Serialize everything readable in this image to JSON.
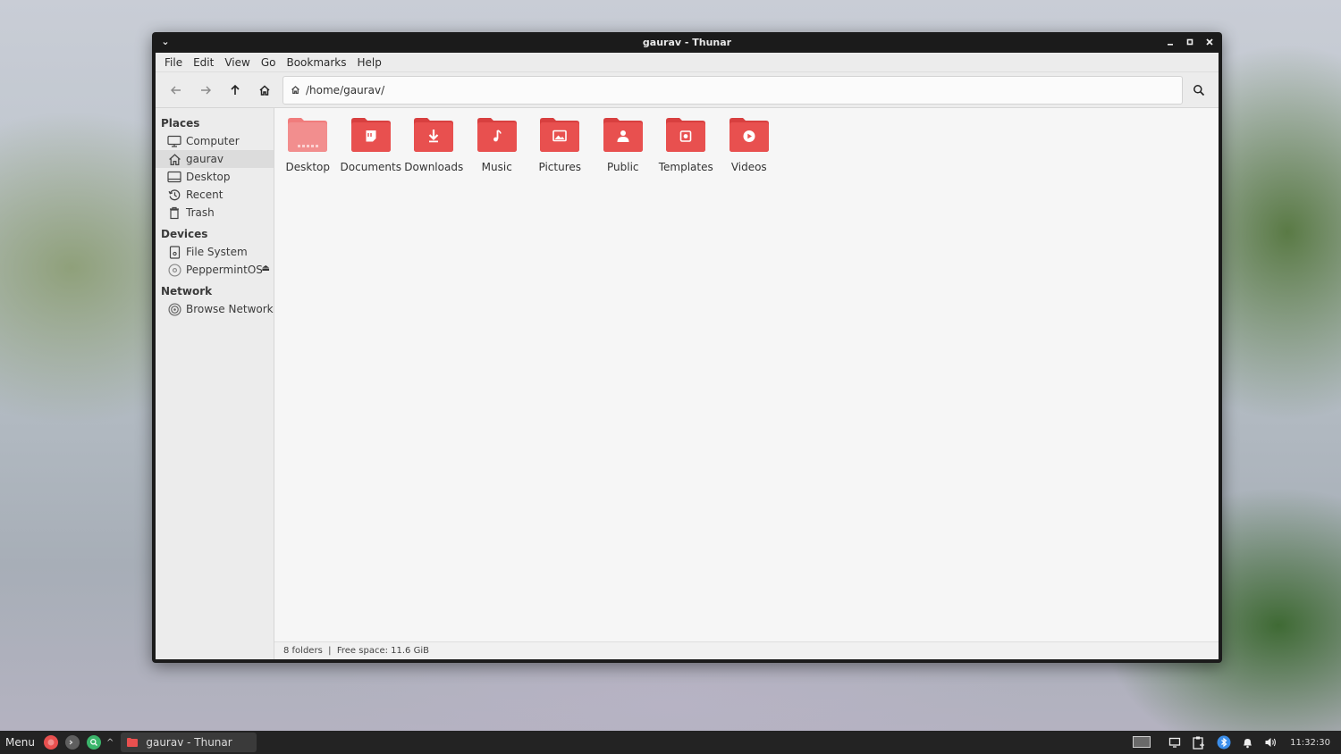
{
  "window": {
    "title": "gaurav - Thunar"
  },
  "menubar": {
    "items": [
      "File",
      "Edit",
      "View",
      "Go",
      "Bookmarks",
      "Help"
    ]
  },
  "toolbar": {
    "back_icon": "arrow-left-icon",
    "forward_icon": "arrow-right-icon",
    "up_icon": "arrow-up-icon",
    "home_icon": "home-icon",
    "location": "/home/gaurav/",
    "search_icon": "search-icon"
  },
  "sidebar": {
    "places_heading": "Places",
    "places": [
      {
        "label": "Computer",
        "icon": "monitor-icon"
      },
      {
        "label": "gaurav",
        "icon": "home-icon"
      },
      {
        "label": "Desktop",
        "icon": "desktop-icon"
      },
      {
        "label": "Recent",
        "icon": "history-icon"
      },
      {
        "label": "Trash",
        "icon": "trash-icon"
      }
    ],
    "devices_heading": "Devices",
    "devices": [
      {
        "label": "File System",
        "icon": "drive-icon"
      },
      {
        "label": "PeppermintOS",
        "icon": "disc-icon"
      }
    ],
    "network_heading": "Network",
    "network": [
      {
        "label": "Browse Network",
        "icon": "network-icon"
      }
    ]
  },
  "folders": [
    {
      "label": "Desktop",
      "emblem": "desktop"
    },
    {
      "label": "Documents",
      "emblem": "document"
    },
    {
      "label": "Downloads",
      "emblem": "download"
    },
    {
      "label": "Music",
      "emblem": "music"
    },
    {
      "label": "Pictures",
      "emblem": "picture"
    },
    {
      "label": "Public",
      "emblem": "user"
    },
    {
      "label": "Templates",
      "emblem": "template"
    },
    {
      "label": "Videos",
      "emblem": "play"
    }
  ],
  "statusbar": {
    "text": "8 folders  |  Free space: 11.6 GiB"
  },
  "taskbar": {
    "menu_label": "Menu",
    "task_label": "gaurav - Thunar",
    "clock": "11:32:30"
  },
  "colors": {
    "folder": "#e8504f",
    "folder_light": "#ef7373",
    "accent_blue": "#3b8eea"
  }
}
